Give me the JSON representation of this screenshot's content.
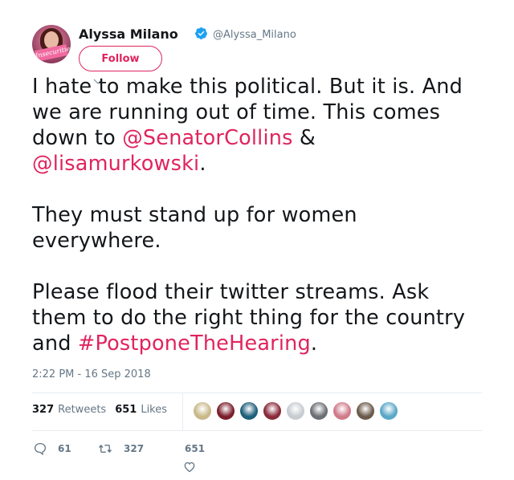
{
  "author": {
    "name": "Alyssa Milano",
    "handle": "@Alyssa_Milano",
    "avatar_badge_text": "Insecurities",
    "verified": true
  },
  "follow_button": {
    "label": "Follow"
  },
  "tweet": {
    "paragraphs": [
      [
        {
          "text": "I hate to make this political. But it is. And we are running out of time. This comes down to ",
          "type": "text"
        },
        {
          "text": "@SenatorCollins",
          "type": "mention"
        },
        {
          "text": " & ",
          "type": "text"
        },
        {
          "text": "@lisamurkowski",
          "type": "mention"
        },
        {
          "text": ".",
          "type": "text"
        }
      ],
      [
        {
          "text": "They must stand up for women everywhere.",
          "type": "text"
        }
      ],
      [
        {
          "text": "Please flood their twitter streams. Ask them to do the right thing for the country and ",
          "type": "text"
        },
        {
          "text": "#PostponeTheHearing",
          "type": "hashtag"
        },
        {
          "text": ".",
          "type": "text"
        }
      ]
    ],
    "timestamp": "2:22 PM - 16 Sep 2018"
  },
  "stats": {
    "retweets_count": "327",
    "retweets_label": "Retweets",
    "likes_count": "651",
    "likes_label": "Likes"
  },
  "liker_avatars": [
    {
      "color": "#c9b98a"
    },
    {
      "color": "#7a1f2b"
    },
    {
      "color": "#1f5f7a"
    },
    {
      "color": "#8a2a3a"
    },
    {
      "color": "#c7ccd1"
    },
    {
      "color": "#6c6f73"
    },
    {
      "color": "#d07a8a"
    },
    {
      "color": "#6b5a4a"
    },
    {
      "color": "#5aa8c8"
    }
  ],
  "actions": {
    "reply_count": "61",
    "retweet_count": "327",
    "like_count": "651"
  },
  "colors": {
    "accent": "#e0245e",
    "verified": "#1da1f2",
    "muted": "#657786"
  }
}
